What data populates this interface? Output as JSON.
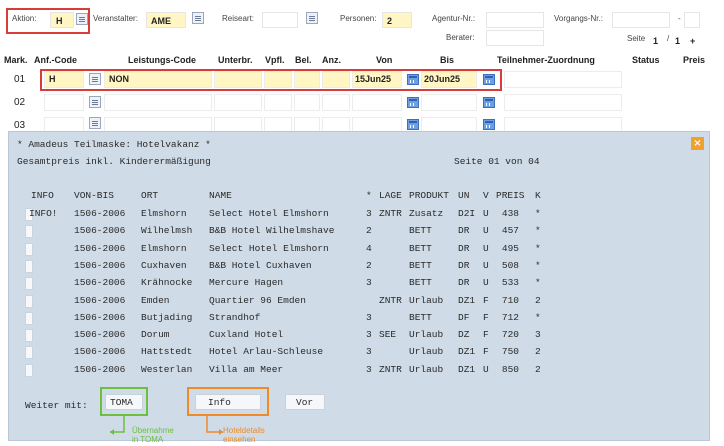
{
  "header": {
    "aktion_label": "Aktion:",
    "aktion_value": "H",
    "veranstalter_label": "Veranstalter:",
    "veranstalter_value": "AME",
    "reiseart_label": "Reiseart:",
    "personen_label": "Personen:",
    "personen_value": "2",
    "agentur_label": "Agentur-Nr.:",
    "vorgangs_label": "Vorgangs-Nr.:",
    "berater_label": "Berater:",
    "seite_label": "Seite",
    "seite_current": "1",
    "seite_sep": "/",
    "seite_total": "1",
    "seite_plus": "+",
    "dash": "-"
  },
  "columns": {
    "mark": "Mark.",
    "anf": "Anf.-Code",
    "leistung": "Leistungs-Code",
    "unterbr": "Unterbr.",
    "vpfl": "Vpfl.",
    "bel": "Bel.",
    "anz": "Anz.",
    "von": "Von",
    "bis": "Bis",
    "teilnehmer": "Teilnehmer-Zuordnung",
    "status": "Status",
    "preis": "Preis"
  },
  "rows": [
    {
      "nr": "01",
      "anf": "H",
      "leistung": "NON",
      "von": "15Jun25",
      "bis": "20Jun25"
    },
    {
      "nr": "02",
      "anf": "",
      "leistung": "",
      "von": "",
      "bis": ""
    },
    {
      "nr": "03",
      "anf": "",
      "leistung": "",
      "von": "",
      "bis": ""
    }
  ],
  "overlay": {
    "title": "* Amadeus Teilmaske: Hotelvakanz *",
    "subtitle": "Gesamtpreis inkl. Kinderermäßigung",
    "page": "Seite 01 von 04",
    "headers": {
      "info": "INFO",
      "vonbis": "VON-BIS",
      "ort": "ORT",
      "name": "NAME",
      "star": "*",
      "lage": "LAGE",
      "produkt": "PRODUKT",
      "un": "UN",
      "v": "V",
      "preis": "PREIS",
      "k": "K"
    },
    "hotels": [
      {
        "info": "INFO!",
        "vonbis": "1506-2006",
        "ort": "Elmshorn",
        "name": "Select Hotel Elmshorn",
        "star": "3",
        "lage": "ZNTR",
        "produkt": "Zusatz",
        "un": "D2I",
        "v": "U",
        "preis": "438",
        "k": "*"
      },
      {
        "info": "",
        "vonbis": "1506-2006",
        "ort": "Wilhelmsh",
        "name": "B&B Hotel Wilhelmshave",
        "star": "2",
        "lage": "",
        "produkt": "BETT",
        "un": "DR",
        "v": "U",
        "preis": "457",
        "k": "*"
      },
      {
        "info": "",
        "vonbis": "1506-2006",
        "ort": "Elmshorn",
        "name": "Select Hotel Elmshorn",
        "star": "4",
        "lage": "",
        "produkt": "BETT",
        "un": "DR",
        "v": "U",
        "preis": "495",
        "k": "*"
      },
      {
        "info": "",
        "vonbis": "1506-2006",
        "ort": "Cuxhaven",
        "name": "B&B Hotel Cuxhaven",
        "star": "2",
        "lage": "",
        "produkt": "BETT",
        "un": "DR",
        "v": "U",
        "preis": "508",
        "k": "*"
      },
      {
        "info": "",
        "vonbis": "1506-2006",
        "ort": "Krähnocke",
        "name": "Mercure Hagen",
        "star": "3",
        "lage": "",
        "produkt": "BETT",
        "un": "DR",
        "v": "U",
        "preis": "533",
        "k": "*"
      },
      {
        "info": "",
        "vonbis": "1506-2006",
        "ort": "Emden",
        "name": "Quartier 96 Emden",
        "star": "",
        "lage": "ZNTR",
        "produkt": "Urlaub",
        "un": "DZ1",
        "v": "F",
        "preis": "710",
        "k": "2"
      },
      {
        "info": "",
        "vonbis": "1506-2006",
        "ort": "Butjading",
        "name": "Strandhof",
        "star": "3",
        "lage": "",
        "produkt": "BETT",
        "un": "DF",
        "v": "F",
        "preis": "712",
        "k": "*"
      },
      {
        "info": "",
        "vonbis": "1506-2006",
        "ort": "Dorum",
        "name": "Cuxland Hotel",
        "star": "3",
        "lage": "SEE",
        "produkt": "Urlaub",
        "un": "DZ",
        "v": "F",
        "preis": "720",
        "k": "3"
      },
      {
        "info": "",
        "vonbis": "1506-2006",
        "ort": "Hattstedt",
        "name": "Hotel Arlau-Schleuse",
        "star": "3",
        "lage": "",
        "produkt": "Urlaub",
        "un": "DZ1",
        "v": "F",
        "preis": "750",
        "k": "2"
      },
      {
        "info": "",
        "vonbis": "1506-2006",
        "ort": "Westerlan",
        "name": "Villa am Meer",
        "star": "3",
        "lage": "ZNTR",
        "produkt": "Urlaub",
        "un": "DZ1",
        "v": "U",
        "preis": "850",
        "k": "2"
      }
    ],
    "weiter_label": "Weiter mit:",
    "weiter_value": "TOMA",
    "info_value": "Info",
    "vor_value": "Vor",
    "annot_green_1": "Übernahme",
    "annot_green_2": "in TOMA",
    "annot_orange_1": "Hoteldetails",
    "annot_orange_2": "einsehen"
  },
  "colors": {
    "red_highlight": "#d93a3a",
    "green_annotation": "#6cbf3f",
    "orange_annotation": "#f08a24",
    "overlay_bg": "#cfdbe6",
    "field_yellow": "#fff6c4"
  },
  "icons": {
    "lookup": "lookup-icon",
    "calendar": "calendar-icon",
    "close": "close-icon"
  }
}
